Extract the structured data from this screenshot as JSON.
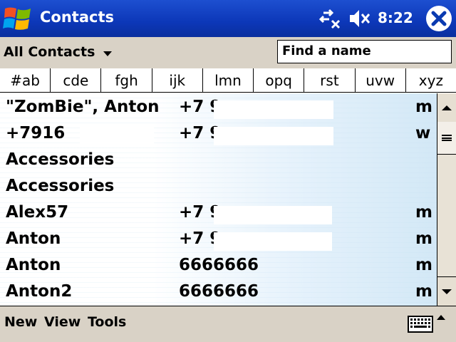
{
  "titlebar": {
    "title": "Contacts",
    "clock": "8:22"
  },
  "filter": {
    "category": "All Contacts",
    "find_placeholder": "Find a name"
  },
  "tabs": [
    "#ab",
    "cde",
    "fgh",
    "ijk",
    "lmn",
    "opq",
    "rst",
    "uvw",
    "xyz"
  ],
  "contacts": [
    {
      "name": "\"ZomBie\", Anton",
      "phone": "+7 9",
      "type": "m"
    },
    {
      "name": "+7916",
      "phone": "+7 9",
      "type": "w"
    },
    {
      "name": "Accessories",
      "phone": "",
      "type": ""
    },
    {
      "name": "Accessories",
      "phone": "",
      "type": ""
    },
    {
      "name": "Alex57",
      "phone": "+7 9",
      "type": "m"
    },
    {
      "name": "Anton",
      "phone": "+7 9",
      "type": "m"
    },
    {
      "name": "Anton",
      "phone": "6666666",
      "type": "m"
    },
    {
      "name": "Anton2",
      "phone": "6666666",
      "type": "m"
    }
  ],
  "menu": {
    "new": "New",
    "view": "View",
    "tools": "Tools"
  }
}
